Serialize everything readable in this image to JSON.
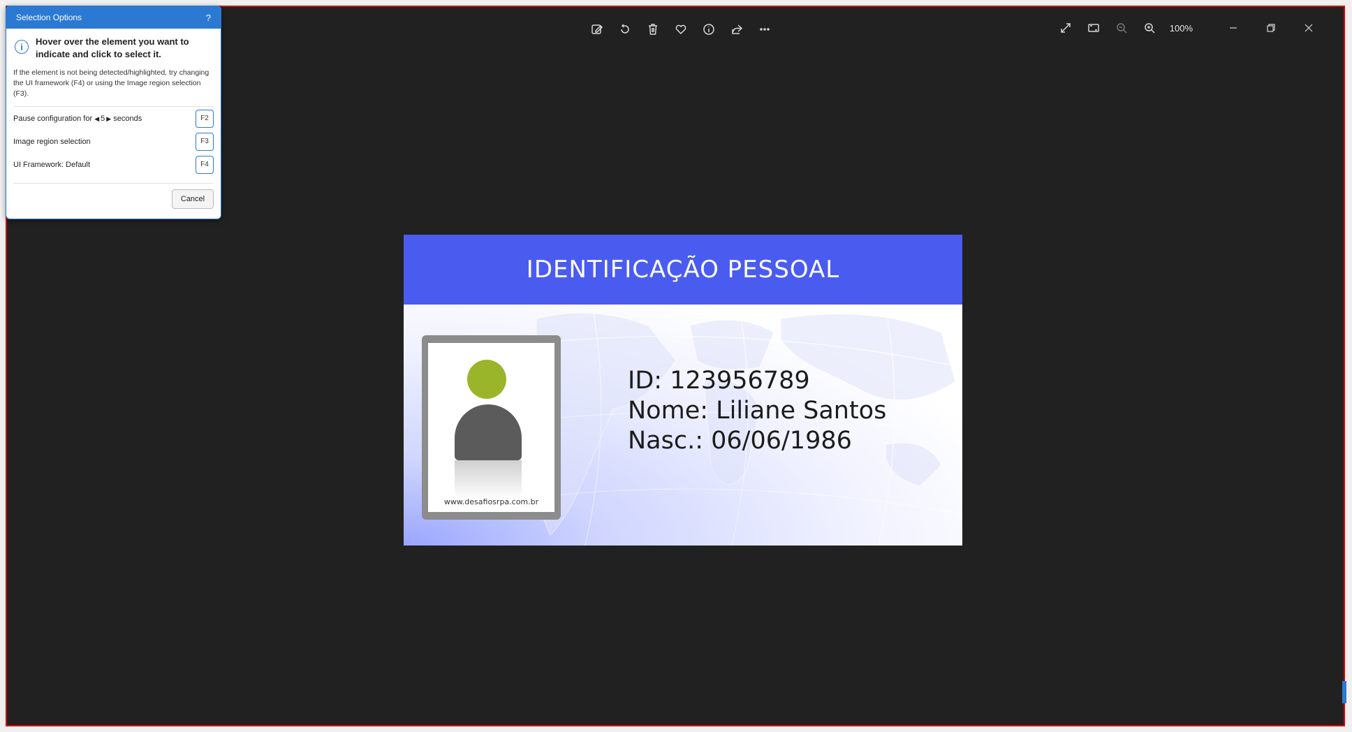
{
  "toolbar": {
    "icons": [
      "edit-icon",
      "rotate-icon",
      "delete-icon",
      "favorite-icon",
      "info-icon",
      "share-icon",
      "more-icon"
    ],
    "right_icons": [
      "expand-icon",
      "fit-icon",
      "zoom-out-icon",
      "zoom-in-icon"
    ],
    "zoom_level": "100%"
  },
  "card": {
    "title": "IDENTIFICAÇÃO PESSOAL",
    "id_line": "ID: 123956789",
    "name_line": "Nome: Liliane Santos",
    "birth_line": "Nasc.: 06/06/1986",
    "photo_url": "www.desafiosrpa.com.br",
    "header_color": "#4a5cf0"
  },
  "dialog": {
    "title": "Selection Options",
    "help": "?",
    "headline": "Hover over the element you want to indicate and click to select it.",
    "hint": "If the element is not being detected/highlighted, try changing the UI framework (F4) or using the Image region selection (F3).",
    "pause_label": "Pause configuration for",
    "pause_value": "5",
    "pause_unit": "seconds",
    "pause_key": "F2",
    "image_region_label": "Image region selection",
    "image_region_key": "F3",
    "framework_label": "UI Framework:  Default",
    "framework_key": "F4",
    "cancel": "Cancel"
  }
}
